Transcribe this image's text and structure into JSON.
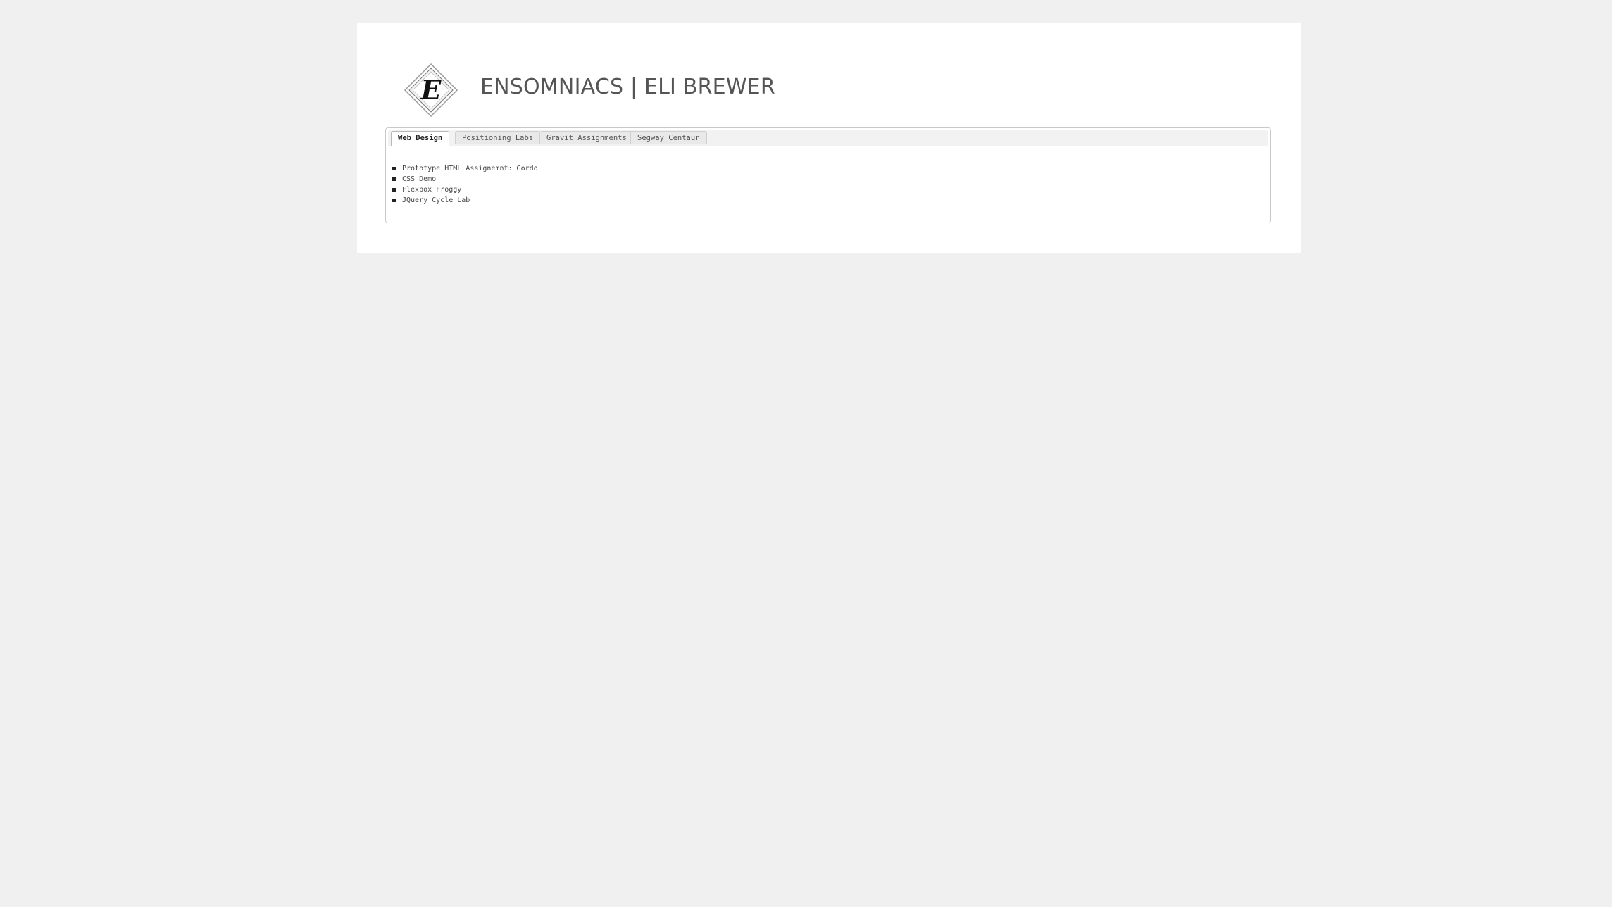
{
  "header": {
    "logo_icon": "ensomniacs-e-diamond-logo",
    "logo_letter": "E",
    "title": "ENSOMNIACS | ELI BREWER"
  },
  "tabs": [
    {
      "label": "Web Design",
      "active": true
    },
    {
      "label": "Positioning Labs",
      "active": false
    },
    {
      "label": "Gravit Assignments",
      "active": false
    },
    {
      "label": "Segway Centaur",
      "active": false
    }
  ],
  "panel": {
    "links": [
      {
        "label": "Prototype HTML Assignemnt: Gordo"
      },
      {
        "label": "CSS Demo"
      },
      {
        "label": "Flexbox Froggy"
      },
      {
        "label": "JQuery Cycle Lab"
      }
    ]
  },
  "colors": {
    "background": "#f0f0f0",
    "page": "#ffffff",
    "title_text": "#555555",
    "tab_bar": "#f2f2f2"
  }
}
